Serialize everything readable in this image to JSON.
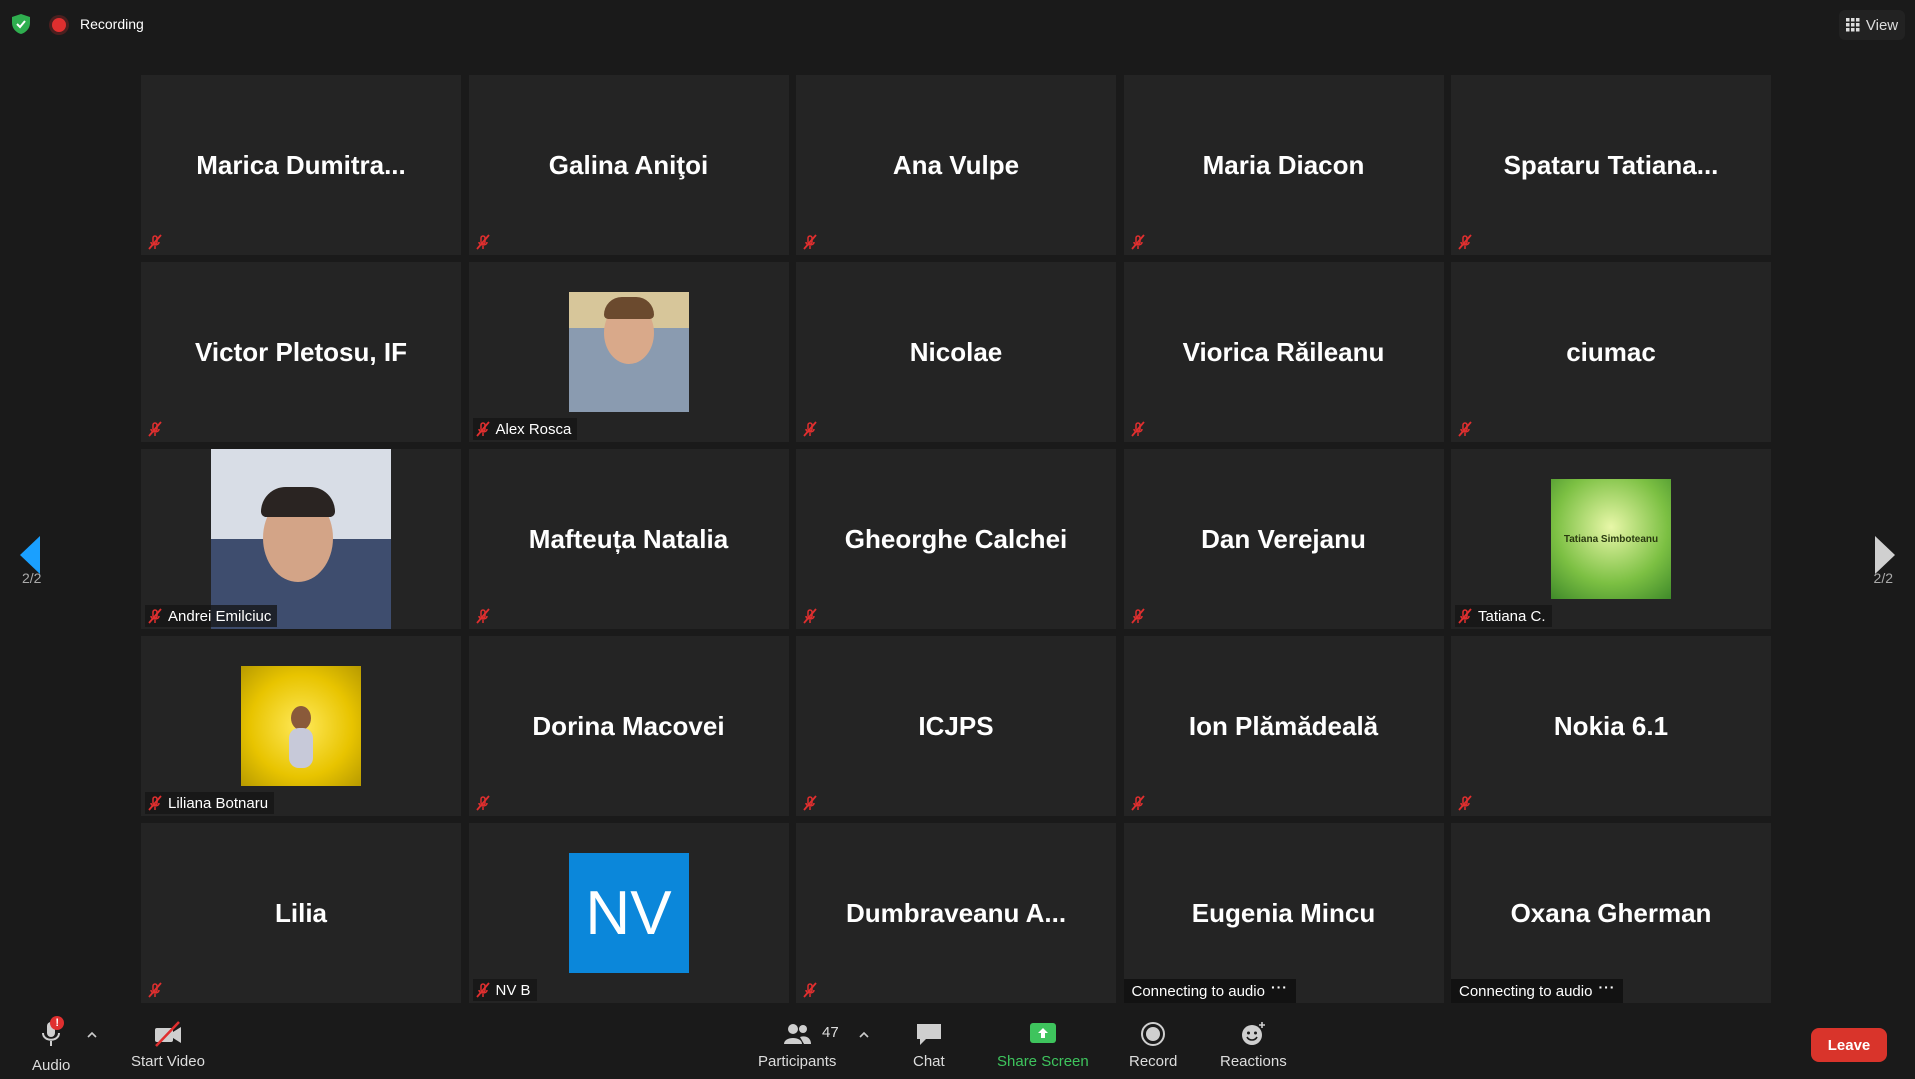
{
  "topbar": {
    "recording_label": "Recording",
    "view_label": "View"
  },
  "pagination": {
    "left_label": "2/2",
    "right_label": "2/2"
  },
  "tiles": [
    {
      "name": "Marica  Dumitra...",
      "foot": ""
    },
    {
      "name": "Galina Aniţoi",
      "foot": ""
    },
    {
      "name": "Ana Vulpe",
      "foot": ""
    },
    {
      "name": "Maria Diacon",
      "foot": ""
    },
    {
      "name": "Spataru  Tatiana...",
      "foot": ""
    },
    {
      "name": "Victor Pletosu, IF",
      "foot": ""
    },
    {
      "name": "",
      "foot": "Alex Rosca"
    },
    {
      "name": "Nicolae",
      "foot": ""
    },
    {
      "name": "Viorica Răileanu",
      "foot": ""
    },
    {
      "name": "ciumac",
      "foot": ""
    },
    {
      "name": "",
      "foot": "Andrei Emilciuc"
    },
    {
      "name": "Mafteuța Natalia",
      "foot": ""
    },
    {
      "name": "Gheorghe Calchei",
      "foot": ""
    },
    {
      "name": "Dan Verejanu",
      "foot": ""
    },
    {
      "name": "",
      "foot": "Tatiana C.",
      "avatar_text": "Tatiana Simboteanu"
    },
    {
      "name": "",
      "foot": "Liliana Botnaru"
    },
    {
      "name": "Dorina Macovei",
      "foot": ""
    },
    {
      "name": "ICJPS",
      "foot": ""
    },
    {
      "name": "Ion Plămădeală",
      "foot": ""
    },
    {
      "name": "Nokia 6.1",
      "foot": ""
    },
    {
      "name": "Lilia",
      "foot": ""
    },
    {
      "name": "",
      "foot": "NV B",
      "avatar_text": "NV"
    },
    {
      "name": "Dumbraveanu  A...",
      "foot": ""
    },
    {
      "name": "Eugenia Mincu",
      "foot": "",
      "connecting": "Connecting to audio"
    },
    {
      "name": "Oxana Gherman",
      "foot": "",
      "connecting": "Connecting to audio"
    }
  ],
  "toolbar": {
    "audio_label": "Audio",
    "audio_badge": "!",
    "video_label": "Start Video",
    "participants_label": "Participants",
    "participants_count": "47",
    "chat_label": "Chat",
    "share_label": "Share Screen",
    "record_label": "Record",
    "reactions_label": "Reactions",
    "leave_label": "Leave"
  },
  "colors": {
    "background": "#1a1a1a",
    "tile": "#242424",
    "share_green": "#3ec45d",
    "leave_red": "#d9342b",
    "mute_red": "#e02f2f",
    "nav_blue": "#1aa0ff"
  }
}
